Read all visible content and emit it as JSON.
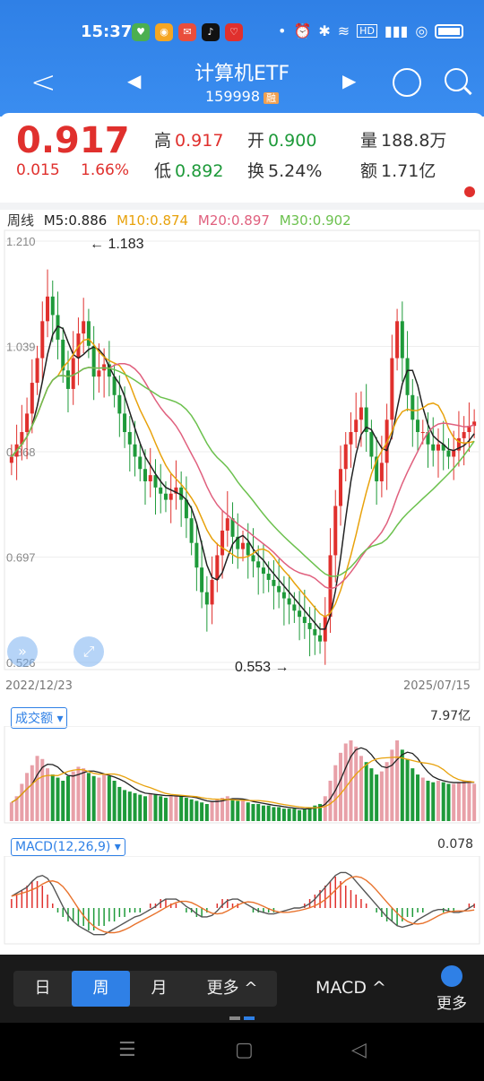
{
  "status": {
    "time": "15:37",
    "battery": "100"
  },
  "header": {
    "title": "计算机ETF",
    "code": "159998",
    "badge": "融"
  },
  "quote": {
    "price": "0.917",
    "change": "0.015",
    "change_pct": "1.66%",
    "high_label": "高",
    "high": "0.917",
    "open_label": "开",
    "open": "0.900",
    "vol_label": "量",
    "vol": "188.8万",
    "low_label": "低",
    "low": "0.892",
    "turn_label": "换",
    "turn": "5.24%",
    "amt_label": "额",
    "amt": "1.71亿"
  },
  "ma": {
    "period": "周线",
    "m5": "M5:0.886",
    "m10": "M10:0.874",
    "m20": "M20:0.897",
    "m30": "M30:0.902"
  },
  "colors": {
    "up": "#e0302d",
    "down": "#1e9a3a",
    "m5": "#222222",
    "m10": "#e8a20c",
    "m20": "#e0607e",
    "m30": "#6cc14e",
    "brand": "#2f80e6"
  },
  "chart_data": {
    "type": "candlestick",
    "y_ticks": [
      "1.210",
      "1.039",
      "0.868",
      "0.697",
      "0.526"
    ],
    "ylim": [
      0.526,
      1.21
    ],
    "start_date": "2022/12/23",
    "end_date": "2025/07/15",
    "max_label": "1.183",
    "min_label": "0.553",
    "closes": [
      0.86,
      0.88,
      0.9,
      0.93,
      0.98,
      1.02,
      1.08,
      1.12,
      1.09,
      1.05,
      1.0,
      0.97,
      1.02,
      1.06,
      1.08,
      1.04,
      0.99,
      1.0,
      1.01,
      0.99,
      0.96,
      0.93,
      0.9,
      0.88,
      0.86,
      0.84,
      0.82,
      0.83,
      0.81,
      0.8,
      0.79,
      0.8,
      0.81,
      0.79,
      0.76,
      0.72,
      0.68,
      0.64,
      0.62,
      0.66,
      0.7,
      0.74,
      0.76,
      0.73,
      0.71,
      0.72,
      0.7,
      0.69,
      0.68,
      0.67,
      0.66,
      0.65,
      0.64,
      0.63,
      0.62,
      0.61,
      0.6,
      0.59,
      0.58,
      0.57,
      0.56,
      0.6,
      0.7,
      0.78,
      0.84,
      0.88,
      0.9,
      0.92,
      0.94,
      0.9,
      0.86,
      0.82,
      0.85,
      0.92,
      1.02,
      1.08,
      1.02,
      0.96,
      0.92,
      0.9,
      0.9,
      0.88,
      0.87,
      0.88,
      0.87,
      0.86,
      0.87,
      0.89,
      0.9,
      0.91,
      0.917
    ],
    "volume_max_label": "7.97亿",
    "volumes": [
      1.2,
      1.6,
      2.4,
      3.1,
      3.6,
      4.2,
      4.0,
      3.4,
      3.0,
      2.8,
      2.6,
      2.9,
      3.2,
      3.5,
      3.4,
      3.1,
      2.9,
      2.8,
      3.0,
      2.9,
      2.6,
      2.2,
      2.0,
      1.9,
      1.8,
      1.7,
      1.6,
      1.8,
      1.7,
      1.6,
      1.5,
      1.6,
      1.7,
      1.6,
      1.5,
      1.4,
      1.3,
      1.2,
      1.1,
      1.3,
      1.4,
      1.5,
      1.6,
      1.4,
      1.3,
      1.3,
      1.2,
      1.1,
      1.1,
      1.0,
      1.0,
      0.9,
      0.9,
      0.8,
      0.8,
      0.8,
      0.7,
      0.8,
      0.9,
      1.0,
      1.1,
      1.6,
      2.6,
      3.6,
      4.4,
      5.0,
      5.2,
      4.8,
      4.2,
      3.8,
      3.4,
      3.0,
      3.2,
      3.8,
      4.6,
      5.2,
      4.6,
      4.0,
      3.4,
      3.0,
      2.8,
      2.6,
      2.5,
      2.6,
      2.5,
      2.4,
      2.4,
      2.5,
      2.6,
      2.6,
      2.4
    ],
    "macd_label": "0.078",
    "macd_hist": [
      0.02,
      0.03,
      0.04,
      0.05,
      0.06,
      0.06,
      0.05,
      0.03,
      0.01,
      -0.01,
      -0.02,
      -0.03,
      -0.03,
      -0.04,
      -0.04,
      -0.05,
      -0.05,
      -0.04,
      -0.04,
      -0.03,
      -0.03,
      -0.02,
      -0.02,
      -0.01,
      -0.01,
      -0.01,
      0.0,
      0.01,
      0.01,
      0.02,
      0.02,
      0.01,
      0.01,
      0.0,
      -0.01,
      -0.01,
      -0.02,
      -0.02,
      -0.01,
      0.0,
      0.01,
      0.02,
      0.02,
      0.01,
      0.01,
      0.0,
      0.0,
      -0.01,
      -0.01,
      -0.01,
      -0.01,
      -0.01,
      0.0,
      0.0,
      0.0,
      0.0,
      0.0,
      0.01,
      0.02,
      0.03,
      0.04,
      0.05,
      0.06,
      0.07,
      0.06,
      0.05,
      0.04,
      0.03,
      0.02,
      0.01,
      0.0,
      -0.01,
      -0.02,
      -0.03,
      -0.03,
      -0.04,
      -0.03,
      -0.02,
      -0.02,
      -0.01,
      -0.01,
      0.0,
      0.0,
      0.0,
      -0.01,
      -0.01,
      -0.01,
      0.0,
      0.0,
      0.01,
      0.01
    ]
  },
  "indicators": {
    "volume_selector": "成交额",
    "macd_selector": "MACD(12,26,9)"
  },
  "bottom": {
    "tab_day": "日",
    "tab_week": "周",
    "tab_month": "月",
    "tab_more": "更多",
    "indicator": "MACD",
    "more": "更多"
  }
}
